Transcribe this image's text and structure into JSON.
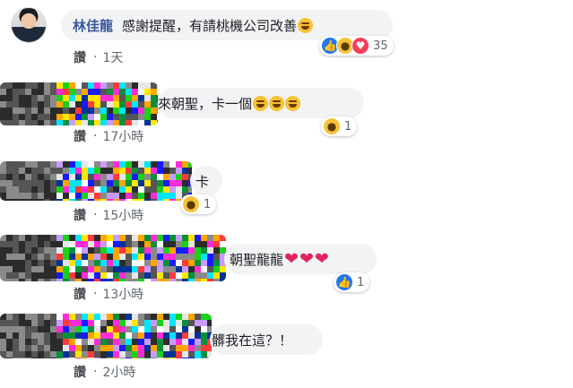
{
  "comments": [
    {
      "author": "林佳龍",
      "text": "感謝提醒，有請桃機公司改善",
      "trailing_emojis": [
        "grinning-sweat"
      ],
      "like_label": "讚",
      "time": "1天",
      "reactions": {
        "icons": [
          "like",
          "wow",
          "love"
        ],
        "count": "35"
      }
    },
    {
      "author": "",
      "text": "來朝聖，卡一個",
      "trailing_emojis": [
        "grinning",
        "grinning",
        "grinning"
      ],
      "like_label": "讚",
      "time": "17小時",
      "reactions": {
        "icons": [
          "haha"
        ],
        "count": "1"
      }
    },
    {
      "author": "",
      "text": "卡",
      "trailing_emojis": [],
      "like_label": "讚",
      "time": "15小時",
      "reactions": {
        "icons": [
          "haha"
        ],
        "count": "1"
      }
    },
    {
      "author": "",
      "text": "朝聖龍龍",
      "trailing_emojis": [
        "heart",
        "heart",
        "heart"
      ],
      "like_label": "讚",
      "time": "13小時",
      "reactions": {
        "icons": [
          "like"
        ],
        "count": "1"
      }
    },
    {
      "author": "",
      "text": "髒我在這？！",
      "trailing_emojis": [],
      "like_label": "讚",
      "time": "2小時",
      "reactions": null
    }
  ],
  "colors": {
    "author": "#385898",
    "bubble": "#f2f3f5",
    "meta": "#606770",
    "like_reaction": "#2078f4",
    "love_reaction": "#f33e58",
    "haha_reaction": "#f7c236"
  }
}
